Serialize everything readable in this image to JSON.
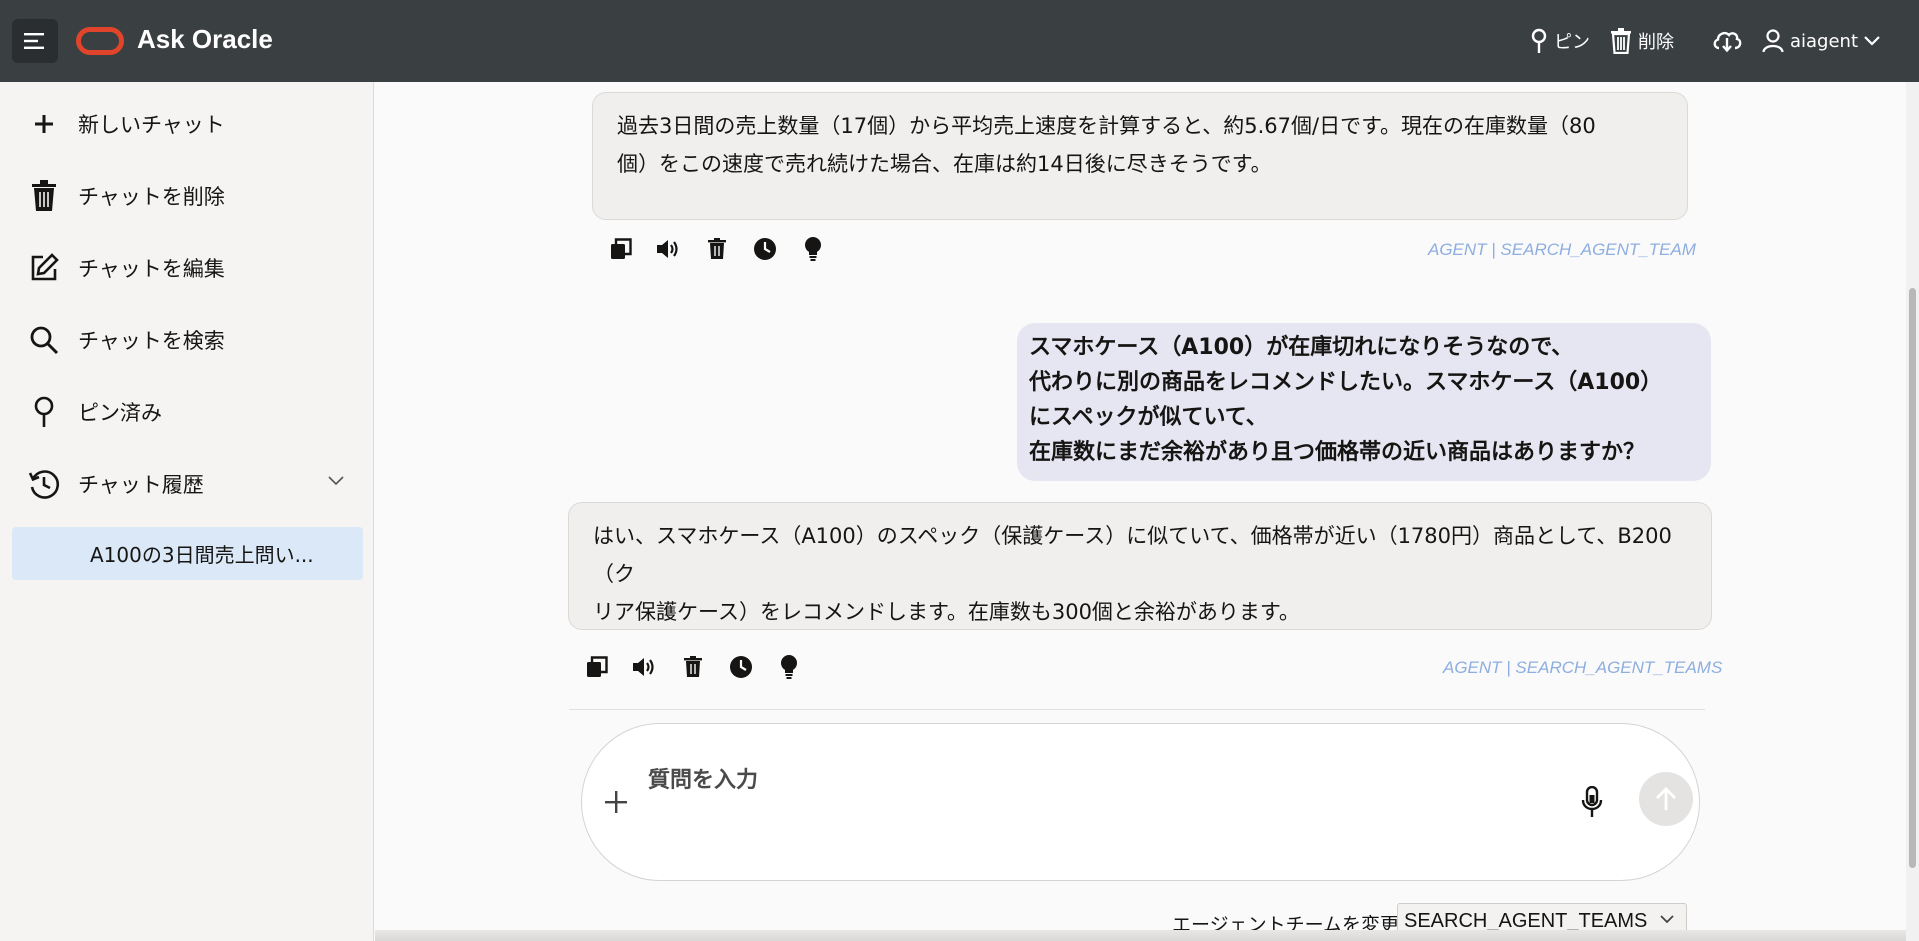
{
  "header": {
    "app_title": "Ask Oracle",
    "pin_label": "ピン",
    "delete_label": "削除",
    "user_name": "aiagent"
  },
  "sidebar": {
    "items": [
      {
        "label": "新しいチャット",
        "icon": "plus-icon"
      },
      {
        "label": "チャットを削除",
        "icon": "trash-icon"
      },
      {
        "label": "チャットを編集",
        "icon": "edit-icon"
      },
      {
        "label": "チャットを検索",
        "icon": "search-icon"
      },
      {
        "label": "ピン済み",
        "icon": "pin-icon"
      },
      {
        "label": "チャット履歴",
        "icon": "history-icon"
      }
    ],
    "history": [
      {
        "label": "A100の3日間売上問い..."
      }
    ]
  },
  "conversation": {
    "agent_message_1": {
      "line1": "過去3日間の売上数量（17個）から平均売上速度を計算すると、約5.67個/日です。現在の在庫数量（80",
      "line2": "個）をこの速度で売れ続けた場合、在庫は約14日後に尽きそうです。",
      "tag": "AGENT | SEARCH_AGENT_TEAM"
    },
    "user_message": {
      "line1": "スマホケース（A100）が在庫切れになりそうなので、",
      "line2": "代わりに別の商品をレコメンドしたい。スマホケース（A100）",
      "line3": "にスペックが似ていて、",
      "line4": "在庫数にまだ余裕があり且つ価格帯の近い商品はありますか？"
    },
    "agent_message_2": {
      "line1": "はい、スマホケース（A100）のスペック（保護ケース）に似ていて、価格帯が近い（1780円）商品として、B200（ク",
      "line2": "リア保護ケース）をレコメンドします。在庫数も300個と余裕があります。",
      "tag": "AGENT | SEARCH_AGENT_TEAMS"
    }
  },
  "composer": {
    "placeholder": "質問を入力"
  },
  "team": {
    "label": "エージェントチームを変更",
    "selected": "SEARCH_AGENT_TEAMS"
  },
  "colors": {
    "header_bg": "#3a3f41",
    "brand_red": "#e0452b",
    "history_selected_bg": "#dbe8f8",
    "user_bubble_bg": "#e6e6f2",
    "agent_tag": "#8eaee0"
  }
}
